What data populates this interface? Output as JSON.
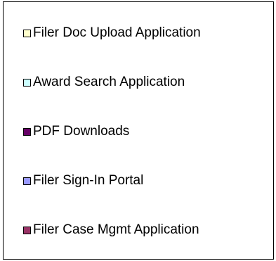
{
  "chart_data": {
    "type": "legend",
    "legend": [
      {
        "label": "Filer Doc Upload Application",
        "color": "#FFFFCC"
      },
      {
        "label": "Award Search Application",
        "color": "#CCFFFF"
      },
      {
        "label": "PDF Downloads",
        "color": "#660066"
      },
      {
        "label": "Filer Sign-In Portal",
        "color": "#9999FF"
      },
      {
        "label": "Filer Case Mgmt Application",
        "color": "#993366"
      }
    ]
  }
}
